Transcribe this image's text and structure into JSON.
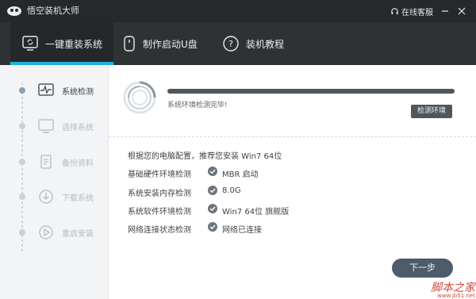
{
  "window": {
    "title": "悟空装机大师",
    "service_label": "在线客服"
  },
  "nav": {
    "tabs": [
      {
        "label": "一键重装系统",
        "active": true
      },
      {
        "label": "制作启动U盘",
        "active": false
      },
      {
        "label": "装机教程",
        "active": false
      }
    ],
    "accent_color": "#1fb1d9"
  },
  "sidebar": {
    "steps": [
      {
        "label": "系统检测",
        "icon": "pulse-monitor-icon",
        "active": true
      },
      {
        "label": "选择系统",
        "icon": "monitor-icon",
        "active": false
      },
      {
        "label": "备份资料",
        "icon": "document-icon",
        "active": false
      },
      {
        "label": "下载系统",
        "icon": "download-icon",
        "active": false
      },
      {
        "label": "重启安装",
        "icon": "restart-icon",
        "active": false
      }
    ]
  },
  "main": {
    "progress": 1.0,
    "status_text": "系统环境检测完毕!",
    "detect_button": "检测环境",
    "summary": "根据您的电脑配置，推荐您安装 Win7 64位",
    "checks": [
      {
        "label": "基础硬件环境检测",
        "value": "MBR 启动"
      },
      {
        "label": "系统安装内存检测",
        "value": "8.0G"
      },
      {
        "label": "系统软件环境检测",
        "value": "Win7 64位 旗舰版"
      },
      {
        "label": "网络连接状态检测",
        "value": "网络已连接"
      }
    ],
    "next_button": "下一步"
  },
  "watermark": {
    "text": "脚本之家",
    "url": "www.jb51.net"
  }
}
